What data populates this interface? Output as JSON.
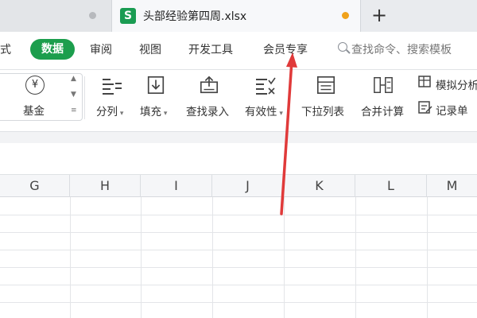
{
  "tabbar": {
    "active_tab_title": "头部经验第四周.xlsx",
    "file_icon_letter": "S",
    "new_tab_symbol": "+",
    "unsaved_dot_color": "#f0a21b",
    "file_icon_color": "#1a9c52"
  },
  "menu": {
    "items": [
      "式",
      "数据",
      "审阅",
      "视图",
      "开发工具",
      "会员专享"
    ],
    "active": "数据",
    "active_color": "#1c9e4d",
    "search_placeholder": "查找命令、搜索模板"
  },
  "ribbon": {
    "currency_symbol": "¥",
    "left_group_label": "基金",
    "tools": [
      {
        "label": "分列",
        "icon": "split-columns-icon",
        "dropdown": true
      },
      {
        "label": "填充",
        "icon": "fill-down-icon",
        "dropdown": true
      },
      {
        "label": "查找录入",
        "icon": "lookup-entry-icon",
        "dropdown": false
      },
      {
        "label": "有效性",
        "icon": "validation-icon",
        "dropdown": true
      },
      {
        "label": "下拉列表",
        "icon": "dropdown-list-icon",
        "dropdown": false
      },
      {
        "label": "合并计算",
        "icon": "consolidate-icon",
        "dropdown": false
      }
    ],
    "right_items": [
      "模拟分析",
      "记录单"
    ]
  },
  "grid": {
    "columns": [
      "G",
      "H",
      "I",
      "J",
      "K",
      "L",
      "M"
    ]
  },
  "annotation": {
    "arrow_color": "#e03a3a"
  }
}
